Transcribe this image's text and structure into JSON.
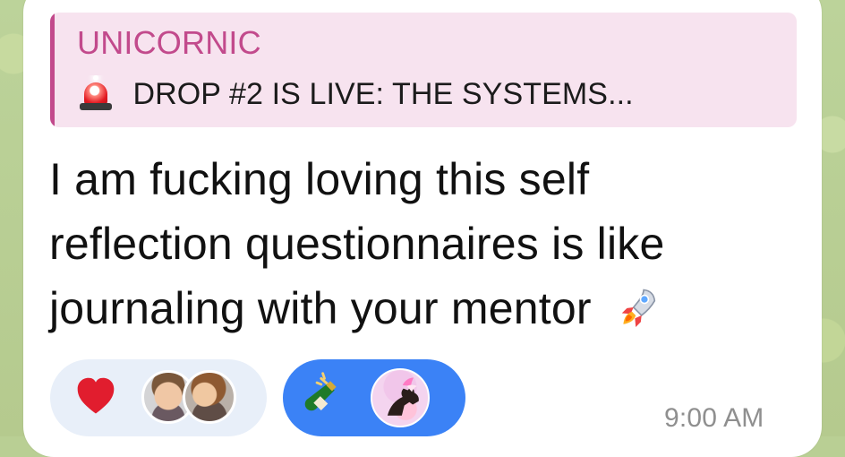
{
  "message": {
    "reply": {
      "author": "UNICORNIC",
      "preview": "DROP #2 IS LIVE: THE SYSTEMS...",
      "icon": "rotating-light-icon"
    },
    "lines": [
      "I am fucking loving this self",
      "reflection questionnaires is like",
      "journaling with your mentor"
    ],
    "trailing_emoji": "rocket-icon",
    "timestamp": "9:00 AM"
  },
  "reactions": [
    {
      "emoji": "heart-icon",
      "users": [
        "avatar",
        "avatar"
      ]
    },
    {
      "emoji": "champagne-bottle-icon",
      "users": [
        "avatar"
      ]
    }
  ],
  "colors": {
    "background": "#b9cf94",
    "bubble": "#ffffff",
    "reply_background": "#f7e3ef",
    "reply_accent": "#c24a8c",
    "reaction_default": "#e8eff9",
    "reaction_selected": "#3b82f6",
    "timestamp": "#8f8f8f"
  }
}
